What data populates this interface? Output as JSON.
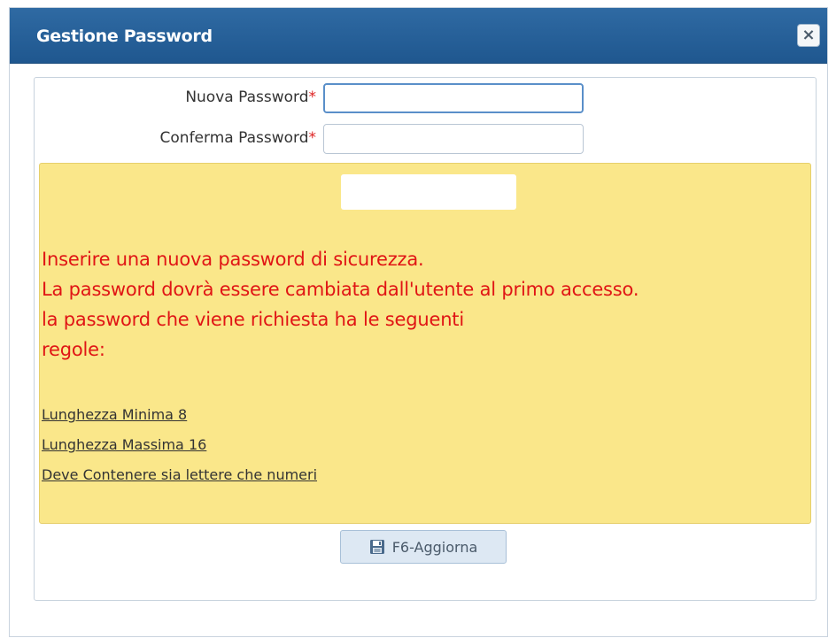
{
  "dialog": {
    "title": "Gestione Password",
    "close_label": "×"
  },
  "form": {
    "new_password_label": "Nuova Password",
    "confirm_password_label": "Conferma Password",
    "required_mark": "*",
    "new_password_value": "",
    "confirm_password_value": ""
  },
  "info": {
    "lines": [
      "Inserire una nuova password di sicurezza.",
      "La password dovrà essere cambiata dall'utente al primo accesso.",
      "la password che viene richiesta ha le seguenti",
      "regole:"
    ],
    "rules": [
      "Lunghezza Minima 8",
      "Lunghezza Massima 16",
      "Deve Contenere sia lettere che numeri"
    ]
  },
  "actions": {
    "update_label": "F6-Aggiorna"
  },
  "icons": {
    "close": "close-icon",
    "save": "floppy-disk-icon"
  }
}
